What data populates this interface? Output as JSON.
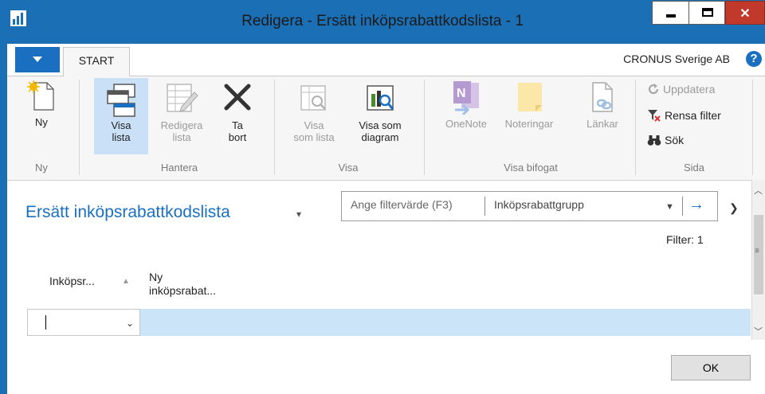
{
  "window": {
    "title": "Redigera - Ersätt inköpsrabattkodslista - 1",
    "min_glyph": "▬",
    "max_glyph": "☐",
    "close_glyph": "✕"
  },
  "ribbon_tabs": {
    "start_label": "START",
    "company": "CRONUS Sverige AB",
    "help": "?"
  },
  "ribbon": {
    "ny": "Ny",
    "visa_lista": "Visa\nlista",
    "redigera_lista": "Redigera\nlista",
    "ta_bort": "Ta\nbort",
    "visa_som_lista": "Visa\nsom lista",
    "visa_som_diagram": "Visa som\ndiagram",
    "onenote": "OneNote",
    "noteringar": "Noteringar",
    "lankar": "Länkar",
    "uppdatera": "Uppdatera",
    "rensa_filter": "Rensa filter",
    "sok": "Sök",
    "groups": {
      "ny": "Ny",
      "hantera": "Hantera",
      "visa": "Visa",
      "visa_bifogat": "Visa bifogat",
      "sida": "Sida"
    }
  },
  "page": {
    "title": "Ersätt inköpsrabattkodslista",
    "filter_placeholder": "Ange filtervärde (F3)",
    "filter_field": "Inköpsrabattgrupp",
    "filter_count": "Filter: 1"
  },
  "table": {
    "columns": [
      "Inköpsr...",
      "Ny\ninköpsrabat..."
    ],
    "rows": [
      {
        "col1": "",
        "col2": ""
      }
    ]
  },
  "footer": {
    "ok_label": "OK"
  },
  "colors": {
    "accent": "#1a6fc1",
    "frame": "#1b6fb5",
    "row_selected": "#cce4f7",
    "close_button": "#c0392b"
  }
}
